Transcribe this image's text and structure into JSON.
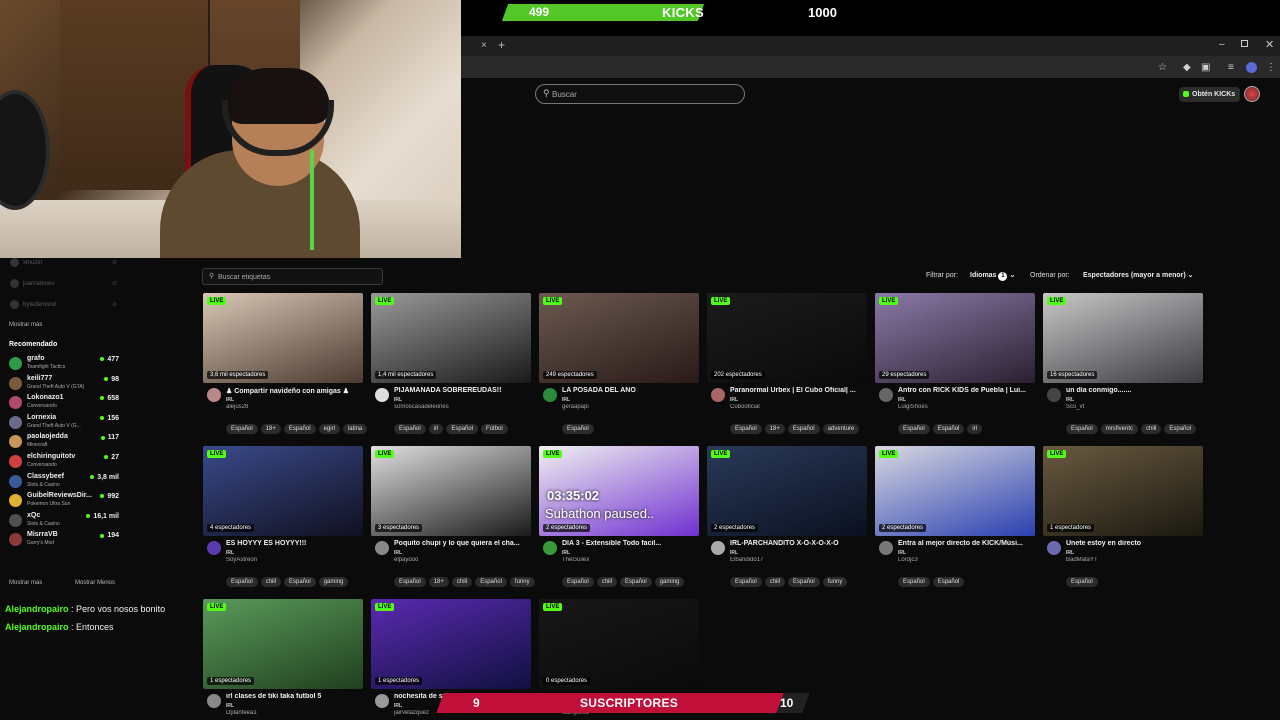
{
  "overlay": {
    "kicks": {
      "current": "499",
      "label": "KICKS",
      "goal": "1000",
      "progress": 0.499,
      "color": "#53c628"
    },
    "subs": {
      "current": "9",
      "label": "SUSCRIPTORES",
      "goal": "10",
      "progress": 0.9,
      "color": "#c0103a"
    }
  },
  "browser": {
    "tab_close": "×",
    "tab_new": "+",
    "win_min": "–",
    "win_close": "✕"
  },
  "site": {
    "search_placeholder": "Buscar",
    "get_kicks": "Obtén KICKs",
    "accent": "#53fc18"
  },
  "sidebar": {
    "faded": [
      "xmuzin",
      "juanramoev",
      "bytedemond"
    ],
    "show_more": "Mostrar más",
    "recommended_title": "Recomendado",
    "recommended": [
      {
        "name": "grafo",
        "game": "Teamfight Tactics",
        "viewers": "477",
        "color": "#2d9c4a"
      },
      {
        "name": "keili777",
        "game": "Grand Theft Auto V (GTA)",
        "viewers": "98",
        "color": "#7a5a3a"
      },
      {
        "name": "Lokonazo1",
        "game": "Conversando",
        "viewers": "658",
        "color": "#b04a6a"
      },
      {
        "name": "Lornexia",
        "game": "Grand Theft Auto V (G...",
        "viewers": "156",
        "color": "#6a6a8a"
      },
      {
        "name": "paolaojedda",
        "game": "Minecraft",
        "viewers": "117",
        "color": "#c8965a"
      },
      {
        "name": "elchiringuitotv",
        "game": "Conversando",
        "viewers": "27",
        "color": "#d04040"
      },
      {
        "name": "Classybeef",
        "game": "Slots & Casino",
        "viewers": "3,8 mil",
        "color": "#3a5a9a"
      },
      {
        "name": "GuibelReviewsDir...",
        "game": "Pokemon Ultra Sun",
        "viewers": "992",
        "color": "#e0b030"
      },
      {
        "name": "xQc",
        "game": "Slots & Casino",
        "viewers": "16,1 mil",
        "color": "#505050"
      },
      {
        "name": "MisrraVB",
        "game": "Garry's Mod",
        "viewers": "194",
        "color": "#8a3a3a"
      }
    ],
    "show_more_2": "Mostrar más",
    "show_less": "Mostrar Menos"
  },
  "chat": [
    {
      "user": "Alejandropairo",
      "message": " : Pero vos nosos bonito"
    },
    {
      "user": "Alejandropairo",
      "message": " : Entonces"
    }
  ],
  "filters": {
    "tag_placeholder": "Buscar etiquetas",
    "filter_label": "Filtrar por:",
    "languages": "Idiomas",
    "languages_count": "1",
    "sort_label": "Ordenar por:",
    "sort_value": "Espectadores (mayor a menor)"
  },
  "streams": [
    {
      "title": "♟ Compartir navideño con amigas ♟",
      "category": "IRL",
      "user": "alejus28",
      "views": "3,6 mil espectadores",
      "tags": [
        "Español",
        "18+",
        "Español",
        "egirl",
        "latina"
      ],
      "bg": [
        "#d8c8b6",
        "#4a3a30"
      ],
      "av": "#b88"
    },
    {
      "title": "PIJAMANADA SOBREREUDAS!!",
      "category": "IRL",
      "user": "somoscasadeleones",
      "views": "1,4 mil espectadores",
      "tags": [
        "Español",
        "irl",
        "Español",
        "Fútbol"
      ],
      "bg": [
        "#9a9a9a",
        "#1a1a1a"
      ],
      "av": "#ddd"
    },
    {
      "title": "LA POSADA DEL AÑO",
      "category": "IRL",
      "user": "geraapapi",
      "views": "249 espectadores",
      "tags": [
        "Español"
      ],
      "bg": [
        "#6a5a50",
        "#2a1a18"
      ],
      "av": "#2a8a3a"
    },
    {
      "title": "Paranormal Urbex | El Cubo Oficial| ...",
      "category": "IRL",
      "user": "Cubooficial",
      "views": "202 espectadores",
      "tags": [
        "Español",
        "18+",
        "Español",
        "adventure"
      ],
      "bg": [
        "#1a1c1a",
        "#0a0a0a"
      ],
      "av": "#a66"
    },
    {
      "title": "Antro con RICK KIDS de Puebla | Lui...",
      "category": "IRL",
      "user": "LuigiShoes",
      "views": "29 espectadores",
      "tags": [
        "Español",
        "Español",
        "irl"
      ],
      "bg": [
        "#8a7aa8",
        "#2a2030"
      ],
      "av": "#666"
    },
    {
      "title": "un día conmigo.......",
      "category": "IRL",
      "user": "Sco_vt",
      "views": "16 espectadores",
      "tags": [
        "Español",
        "mrsfiventc",
        "chill",
        "Español"
      ],
      "bg": [
        "#c8c8c8",
        "#3a3a40"
      ],
      "av": "#444"
    },
    {
      "title": "ES HOYYY ES HOYYY!!!",
      "category": "IRL",
      "user": "SoyAstreon",
      "views": "4 espectadores",
      "tags": [
        "Español",
        "chill",
        "Español",
        "gaming"
      ],
      "bg": [
        "#3a4a8a",
        "#101020"
      ],
      "av": "#5a3ab0"
    },
    {
      "title": "Poquito chupi y lo que quiera el cha...",
      "category": "IRL",
      "user": "elpayooo",
      "views": "3 espectadores",
      "tags": [
        "Español",
        "18+",
        "chill",
        "Español",
        "funny"
      ],
      "bg": [
        "#e0e0e0",
        "#1a1a1a"
      ],
      "av": "#888"
    },
    {
      "title": "DIA 3 - Extensible Todo facil...",
      "category": "IRL",
      "user": "TheGuilex",
      "views": "2 espectadores",
      "tags": [
        "Español",
        "chill",
        "Español",
        "gaming"
      ],
      "bg": [
        "#f0f0f0",
        "#7030d0"
      ],
      "av": "#3a9a3a",
      "clock": "03:35:02",
      "subathon": "Subathon paused.."
    },
    {
      "title": "IRL-PARCHANDITO X-O-X-O-X-O",
      "category": "IRL",
      "user": "Elbandido17",
      "views": "2 espectadores",
      "tags": [
        "Español",
        "chill",
        "Español",
        "funny"
      ],
      "bg": [
        "#2a3a5a",
        "#0a1020"
      ],
      "av": "#aaa"
    },
    {
      "title": "Entra al mejor directo de KICK/Músi...",
      "category": "IRL",
      "user": "Lordjc3",
      "views": "2 espectadores",
      "tags": [
        "Español",
        "Español"
      ],
      "bg": [
        "#d8d8e0",
        "#2a40b0"
      ],
      "av": "#777"
    },
    {
      "title": "Unete estoy en directo",
      "category": "IRL",
      "user": "BadMataYT",
      "views": "1 espectadores",
      "tags": [
        "Español"
      ],
      "bg": [
        "#6a5a40",
        "#1a1810"
      ],
      "av": "#6a6ab0"
    },
    {
      "title": "irl clases de tiki taka futbol 5",
      "category": "IRL",
      "user": "Dplanteea1",
      "views": "1 espectadores",
      "tags": [],
      "bg": [
        "#5a9a5a",
        "#20401e"
      ],
      "av": "#888"
    },
    {
      "title": "nochesita de stre...",
      "category": "IRL",
      "user": "jairvelazquez",
      "views": "1 espectadores",
      "tags": [],
      "bg": [
        "#5a2ab0",
        "#101040"
      ],
      "av": "#999"
    },
    {
      "title": "",
      "category": "",
      "user": "Sampie05",
      "views": "0 espectadores",
      "tags": [],
      "bg": [
        "#181818",
        "#0a0a0a"
      ],
      "av": "#333"
    }
  ],
  "live_label": "LIVE"
}
